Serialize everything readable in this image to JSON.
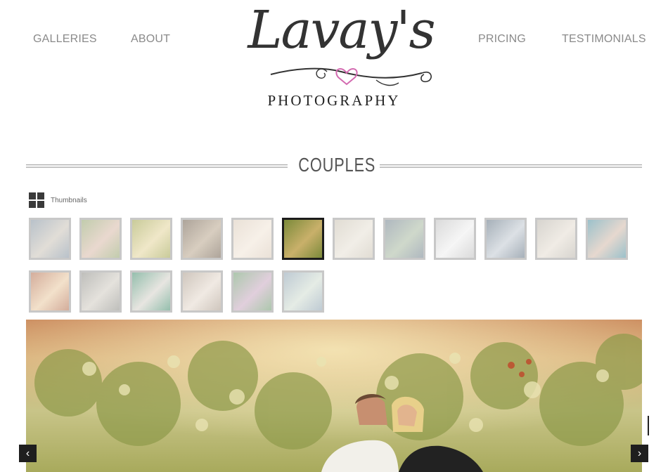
{
  "nav": {
    "galleries": "GALLERIES",
    "about": "ABOUT",
    "pricing": "PRICING",
    "testimonials": "TESTIMONIALS"
  },
  "logo": {
    "script_text": "Lavay's",
    "subtitle": "PHOTOGRAPHY",
    "heart_color": "#d36ab0"
  },
  "gallery": {
    "title": "COUPLES",
    "thumbnails_label": "Thumbnails",
    "selected_index": 5,
    "thumbnails": [
      {
        "c1": "#7f8f9f",
        "c2": "#c9c2b6"
      },
      {
        "c1": "#8fa36a",
        "c2": "#d8b9a8"
      },
      {
        "c1": "#9ca047",
        "c2": "#e3d49c"
      },
      {
        "c1": "#6b5a48",
        "c2": "#b8a58c"
      },
      {
        "c1": "#d9c9b7",
        "c2": "#f0e4d6"
      },
      {
        "c1": "#7b8a3a",
        "c2": "#c9b06a"
      },
      {
        "c1": "#c8c0b0",
        "c2": "#e6e0d4"
      },
      {
        "c1": "#6e7e8c",
        "c2": "#a8b9a0"
      },
      {
        "c1": "#bdbdbd",
        "c2": "#eeeeee"
      },
      {
        "c1": "#5e7080",
        "c2": "#c0c8d0"
      },
      {
        "c1": "#b7b2a8",
        "c2": "#e4dcd0"
      },
      {
        "c1": "#4a8ea0",
        "c2": "#d2b8a8"
      },
      {
        "c1": "#b06a4a",
        "c2": "#e8c8a0"
      },
      {
        "c1": "#8a8a84",
        "c2": "#cfcac0"
      },
      {
        "c1": "#3e8a6a",
        "c2": "#d4d0c8"
      },
      {
        "c1": "#a89888",
        "c2": "#e4d8cc"
      },
      {
        "c1": "#6a9a6a",
        "c2": "#c8a8c0"
      },
      {
        "c1": "#8aa0b0",
        "c2": "#d0dcd0"
      }
    ]
  },
  "controls": {
    "prev_glyph": "‹",
    "next_glyph": "›"
  }
}
